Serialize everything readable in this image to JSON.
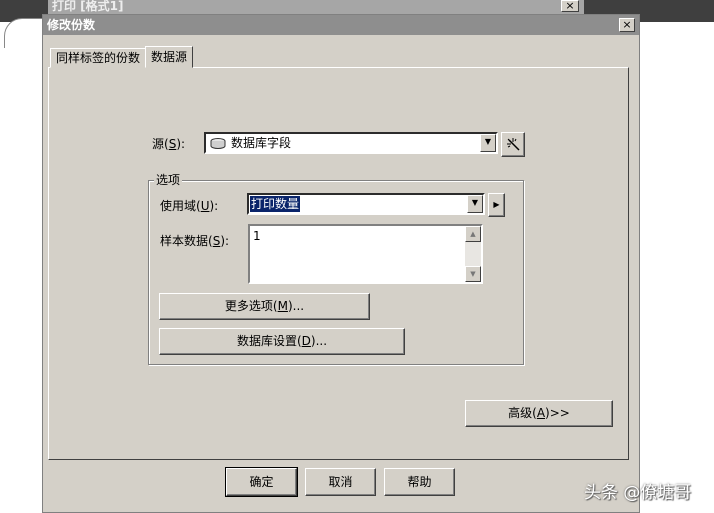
{
  "background_window": {
    "title": "打印 [格式1]",
    "close_glyph": "×"
  },
  "dialog": {
    "title": "修改份数",
    "close_glyph": "×",
    "tabs": [
      {
        "label": "同样标签的份数"
      },
      {
        "label": "数据源"
      }
    ],
    "source": {
      "label_pre": "源(",
      "label_key": "S",
      "label_post": "):",
      "value": "数据库字段",
      "icon": "database-icon",
      "wizard_icon": "magic-wand-icon"
    },
    "options_group": {
      "title": "选项",
      "use_field": {
        "label_pre": "使用域(",
        "label_key": "U",
        "label_post": "):",
        "value": "打印数量"
      },
      "sample_data": {
        "label_pre": "样本数据(",
        "label_key": "S",
        "label_post": "):",
        "value": "1"
      },
      "more_options_button": {
        "pre": "更多选项(",
        "key": "M",
        "post": ")..."
      },
      "db_settings_button": {
        "pre": "数据库设置(",
        "key": "D",
        "post": ")..."
      }
    },
    "advanced_button": {
      "pre": "高级(",
      "key": "A",
      "post": ")>>"
    },
    "footer": {
      "ok": "确定",
      "cancel": "取消",
      "help": "帮助"
    }
  },
  "watermark": "头条 @僚塘哥"
}
